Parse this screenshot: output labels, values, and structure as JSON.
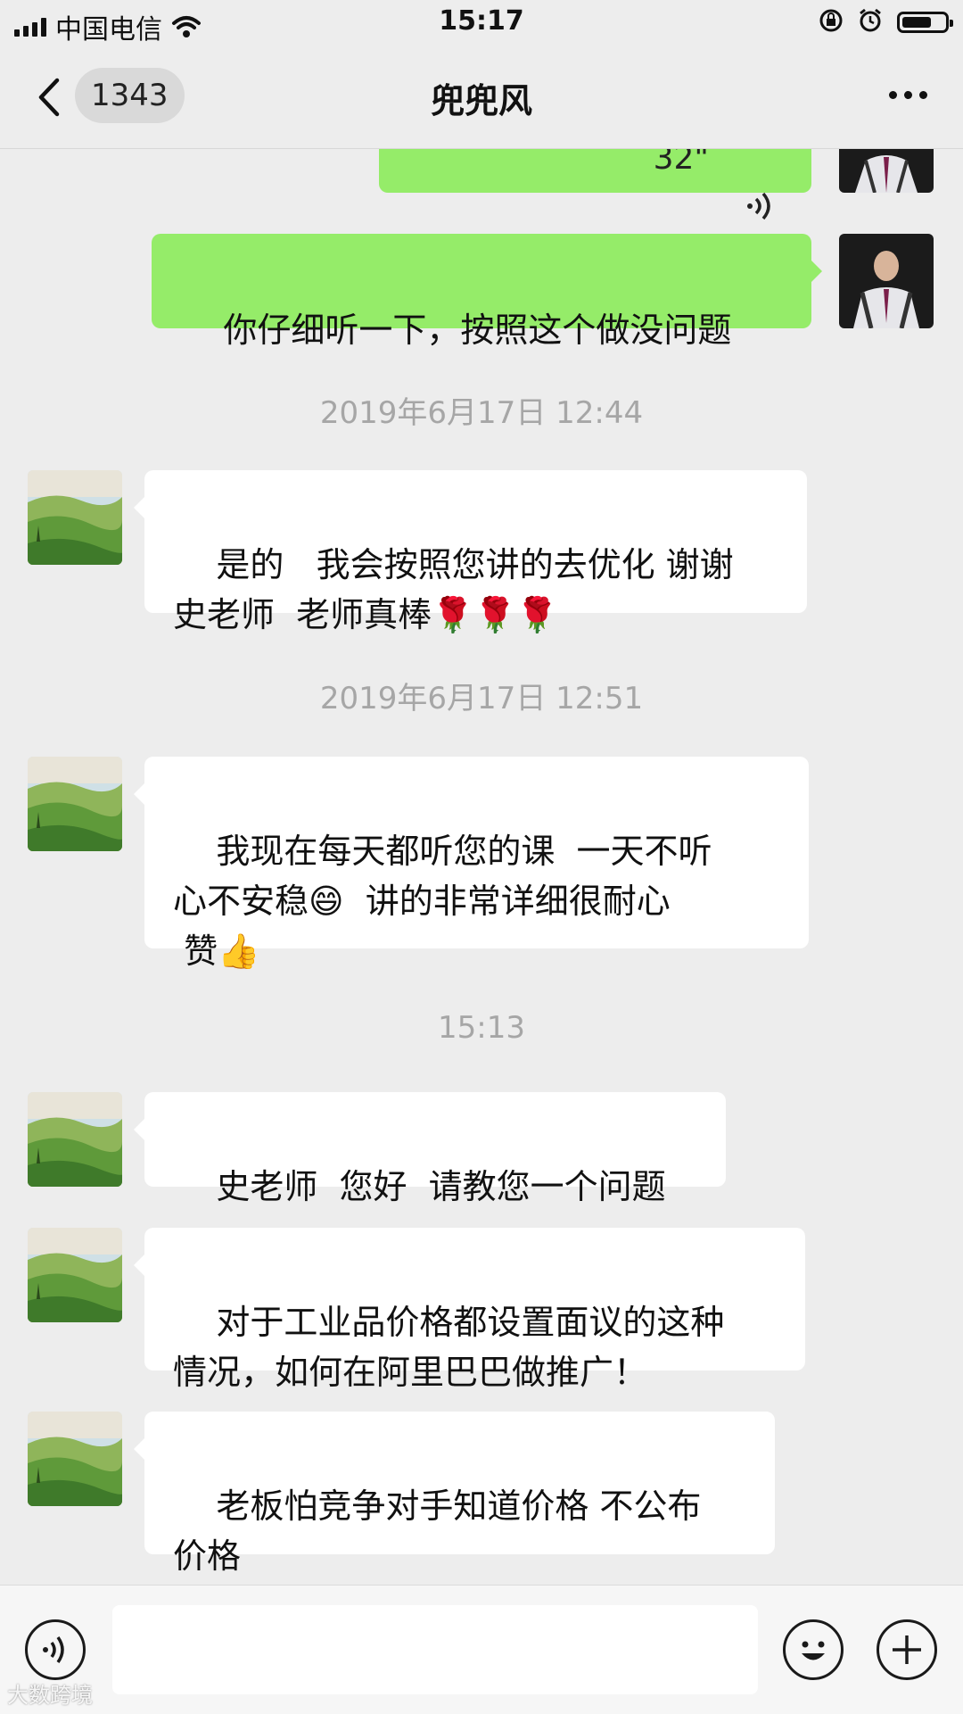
{
  "status": {
    "carrier": "中国电信",
    "time": "15:17"
  },
  "header": {
    "unread_count": "1343",
    "title": "兜兜风"
  },
  "messages": {
    "voice_duration": "32\"",
    "out_text": "你仔细听一下，按照这个做没问题",
    "ts1": "2019年6月17日 12:44",
    "m1": "是的   我会按照您讲的去优化 谢谢\n史老师  老师真棒🌹🌹🌹",
    "ts2": "2019年6月17日 12:51",
    "m2": "我现在每天都听您的课  一天不听\n心不安稳😄  讲的非常详细很耐心\n 赞👍",
    "ts3": "15:13",
    "m3": "史老师  您好  请教您一个问题",
    "m4": "对于工业品价格都设置面议的这种\n情况，如何在阿里巴巴做推广！",
    "m5": "老板怕竞争对手知道价格 不公布\n价格"
  },
  "input": {
    "placeholder": ""
  },
  "watermark": "大数跨境",
  "icons": {
    "back": "chevron-left-icon",
    "more": "more-dots-icon",
    "voice": "voice-input-icon",
    "emoji": "emoji-icon",
    "add": "plus-icon"
  }
}
